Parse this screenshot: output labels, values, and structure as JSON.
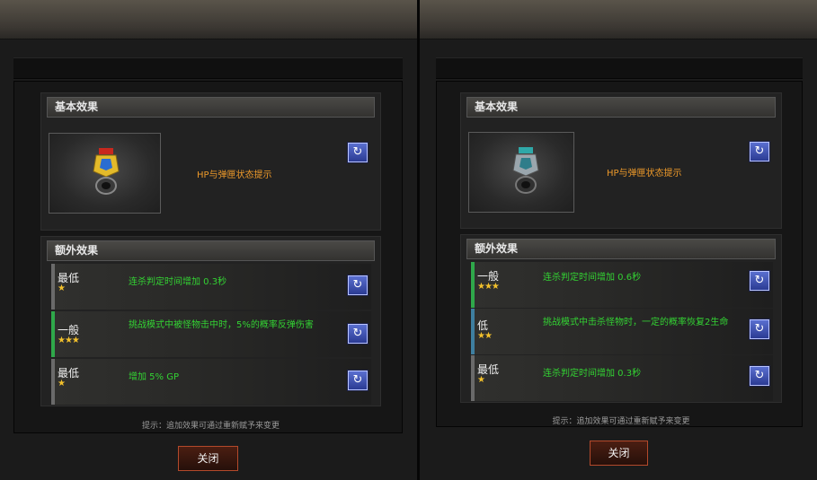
{
  "left": {
    "basic_title": "基本效果",
    "basic_effect": "HP与弹匣状态提示",
    "extra_title": "额外效果",
    "extras": [
      {
        "grade": "最低",
        "stars": "★",
        "desc": "连杀判定时间增加 0.3秒",
        "color": "#6a6a6a"
      },
      {
        "grade": "一般",
        "stars": "★★★",
        "desc": "挑战模式中被怪物击中时，5%的概率反弹伤害",
        "color": "#2fa84a"
      },
      {
        "grade": "最低",
        "stars": "★",
        "desc": "增加 5% GP",
        "color": "#6a6a6a"
      }
    ],
    "hint": "提示：追加效果可通过重新赋予来变更",
    "close": "关闭"
  },
  "right": {
    "basic_title": "基本效果",
    "basic_effect": "HP与弹匣状态提示",
    "extra_title": "额外效果",
    "extras": [
      {
        "grade": "一般",
        "stars": "★★★",
        "desc": "连杀判定时间增加 0.6秒",
        "color": "#2fa84a"
      },
      {
        "grade": "低",
        "stars": "★★",
        "desc": "挑战模式中击杀怪物时，一定的概率恢复2生命",
        "color": "#3e7fa0"
      },
      {
        "grade": "最低",
        "stars": "★",
        "desc": "连杀判定时间增加 0.3秒",
        "color": "#6a6a6a"
      }
    ],
    "hint": "提示：追加效果可通过重新赋予来变更",
    "close": "关闭"
  },
  "icons": {
    "reroll": "reroll-icon",
    "item": "item-helmet-icon"
  }
}
